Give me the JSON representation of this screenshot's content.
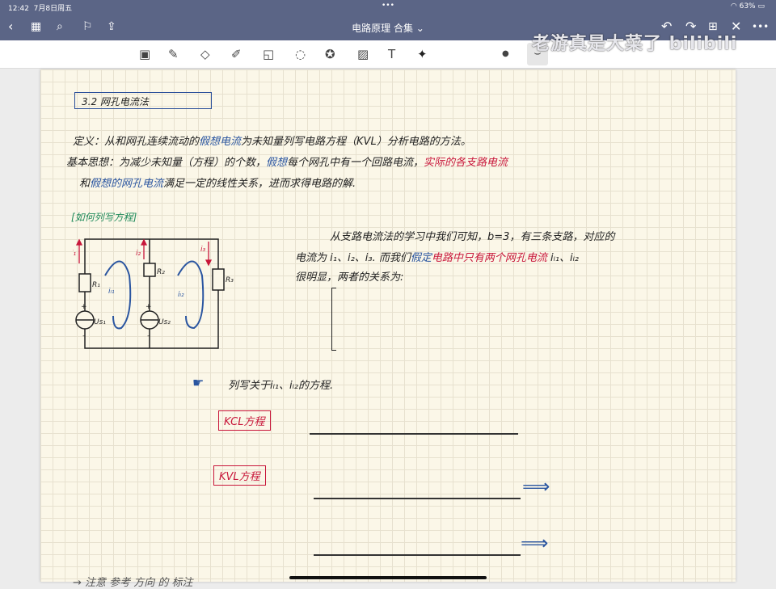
{
  "status": {
    "time": "12:42",
    "date": "7月8日周五",
    "battery": "63%"
  },
  "nav": {
    "title": "电路原理 合集",
    "watermark": "老游真是大菜了 bilibili"
  },
  "toolbar": {
    "tools": [
      "lasso-shape",
      "pen",
      "eraser",
      "highlighter",
      "shapes",
      "lasso",
      "sticker",
      "image",
      "text",
      "laser-pointer"
    ]
  },
  "note": {
    "section": "3.2  网孔电流法",
    "def_line1_a": "定义：从和网孔连续流动的",
    "def_line1_b": "假想电流",
    "def_line1_c": "为未知量列写电路方程（KVL）分析电路的方法。",
    "idea_a": "基本思想：为减少未知量（方程）的个数，",
    "idea_b": "假想",
    "idea_c": "每个网孔中有一个回路电流，",
    "idea_d": "实际的各支路电流",
    "idea2_a": "和",
    "idea2_b": "假想的网孔电流",
    "idea2_c": "满足一定的线性关系，进而求得电路的解.",
    "example": "[如何列写方程]",
    "p1": "从支路电流法的学习中我们可知，b=3，有三条支路，对应的",
    "p2_a": "电流为 i₁、i₂、i₃. 而我们",
    "p2_b": "假定",
    "p2_c": "电路中只有两个网孔电流",
    "p2_d": " iₗ₁、iₗ₂",
    "p3": "很明显，两者的关系为:",
    "pointer": "列写关于iₗ₁、iₗ₂的方程.",
    "kcl": "KCL方程",
    "kvl": "KVL方程",
    "bottom": "→ 注意 参考 方向 的 标注",
    "circuit": {
      "i1": "i₁",
      "i2": "i₂",
      "i3": "i₃",
      "r1": "R₁",
      "r2": "R₂",
      "r3": "R₃",
      "il1": "iₗ₁",
      "il2": "iₗ₂",
      "us1": "Us₁",
      "us2": "Us₂",
      "plus": "+",
      "minus": "-"
    }
  }
}
